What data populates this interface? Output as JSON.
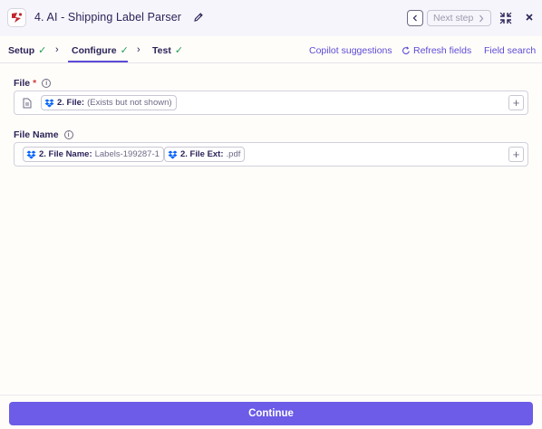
{
  "header": {
    "title": "4. AI - Shipping Label Parser",
    "next_step_label": "Next step"
  },
  "tabs": [
    {
      "label": "Setup",
      "complete": true
    },
    {
      "label": "Configure",
      "complete": true,
      "active": true
    },
    {
      "label": "Test",
      "complete": true
    }
  ],
  "links": {
    "copilot": "Copilot suggestions",
    "refresh": "Refresh fields",
    "field_search": "Field search"
  },
  "fields": {
    "file": {
      "label": "File",
      "required_mark": "*",
      "pill": {
        "label": "2. File:",
        "value": "(Exists but not shown)"
      }
    },
    "file_name": {
      "label": "File Name",
      "pills": [
        {
          "label": "2. File Name:",
          "value": "Labels-199287-1"
        },
        {
          "label": "2. File Ext:",
          "value": ".pdf"
        }
      ]
    }
  },
  "footer": {
    "continue_label": "Continue"
  },
  "colors": {
    "accent": "#6c5ce7",
    "link": "#5d4bd8",
    "check": "#1f9d55",
    "required": "#d23b3b",
    "dropbox": "#0061fe"
  },
  "icons": {
    "app": "zapier-ai-icon",
    "pill": "dropbox-icon"
  }
}
